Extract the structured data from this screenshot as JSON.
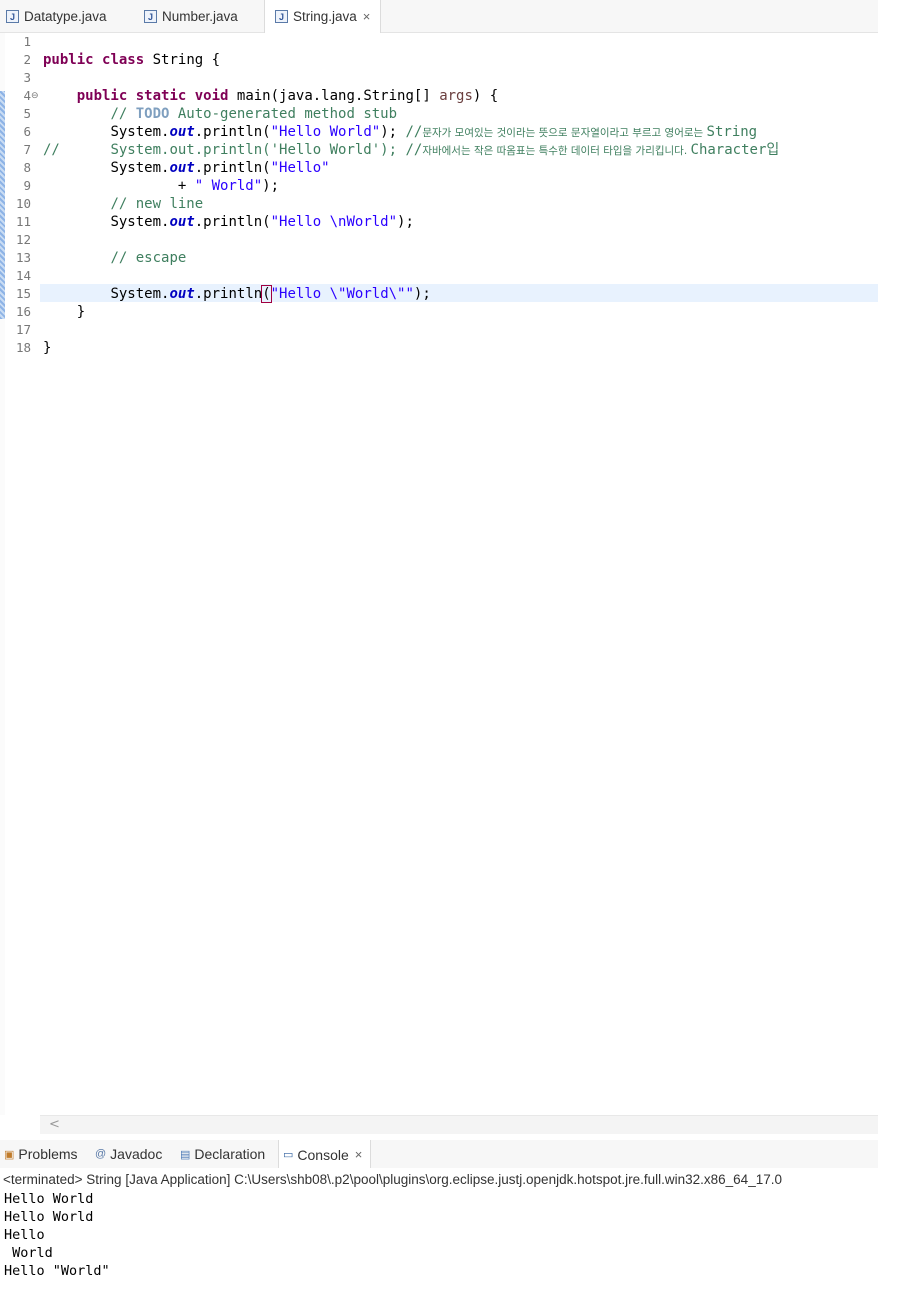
{
  "editor_tabs": [
    {
      "label": "Datatype.java",
      "icon": "java-file-icon"
    },
    {
      "label": "Number.java",
      "icon": "java-file-icon"
    },
    {
      "label": "String.java",
      "icon": "java-file-icon",
      "active": true,
      "close": "×"
    }
  ],
  "editor": {
    "line_numbers": [
      "1",
      "2",
      "3",
      "4",
      "5",
      "6",
      "7",
      "8",
      "9",
      "10",
      "11",
      "12",
      "13",
      "14",
      "15",
      "16",
      "17",
      "18"
    ],
    "fold_marker": "⊖",
    "line2": {
      "kw1": "public",
      "kw2": "class",
      "rest": " String {"
    },
    "line4": {
      "kw1": "public",
      "kw2": "static",
      "kw3": "void",
      "rest1": " main(java.lang.String[] ",
      "param": "args",
      "rest2": ") {"
    },
    "line5": {
      "c1": "// ",
      "todo": "TODO",
      "c2": " Auto-generated method stub"
    },
    "line6": {
      "a": "System.",
      "out": "out",
      "b": ".println(",
      "str": "\"Hello World\"",
      "c": "); ",
      "comment_slashes": "//",
      "comment_text": "문자가 모여있는 것이라는 뜻으로 문자열이라고 부르고 영어로는 ",
      "comment_end": "String"
    },
    "line7": {
      "prefix": "//",
      "code": "System.out.println('Hello World'); ",
      "comment_slashes": "//",
      "comment_text": "자바에서는 작은 따옴표는 특수한 데이터 타입을 가리킵니다. ",
      "comment_end": "Character입"
    },
    "line8": {
      "a": "System.",
      "out": "out",
      "b": ".println(",
      "str": "\"Hello\""
    },
    "line9": {
      "op": "+ ",
      "str": "\" World\"",
      "end": ");"
    },
    "line10": {
      "comment": "// new line"
    },
    "line11": {
      "a": "System.",
      "out": "out",
      "b": ".println(",
      "str": "\"Hello \\nWorld\"",
      "end": ");"
    },
    "line13": {
      "comment": "// escape"
    },
    "line14": {
      "a": "System.",
      "out": "out",
      "b": ".println",
      "paren": "(",
      "str": "\"Hello \\\"World\\\"\"",
      "end": ");"
    },
    "line15": {
      "brace": "}"
    },
    "line17": {
      "brace": "}"
    }
  },
  "bottom_tabs": [
    {
      "label": "Problems",
      "icon": "problems-icon"
    },
    {
      "label": "Javadoc",
      "icon": "javadoc-icon"
    },
    {
      "label": "Declaration",
      "icon": "declaration-icon"
    },
    {
      "label": "Console",
      "icon": "console-icon",
      "active": true,
      "close": "×"
    }
  ],
  "console": {
    "terminated": "<terminated> String [Java Application] C:\\Users\\shb08\\.p2\\pool\\plugins\\org.eclipse.justj.openjdk.hotspot.jre.full.win32.x86_64_17.0",
    "output": [
      "Hello World",
      "Hello World",
      "Hello",
      " World",
      "Hello \"World\""
    ]
  },
  "scroll_arrow": "<",
  "colors": {
    "keyword": "#7f0055",
    "comment": "#3f7f5f",
    "string": "#2a00ff",
    "field": "#0000c0",
    "current_line": "#e8f2fe"
  }
}
